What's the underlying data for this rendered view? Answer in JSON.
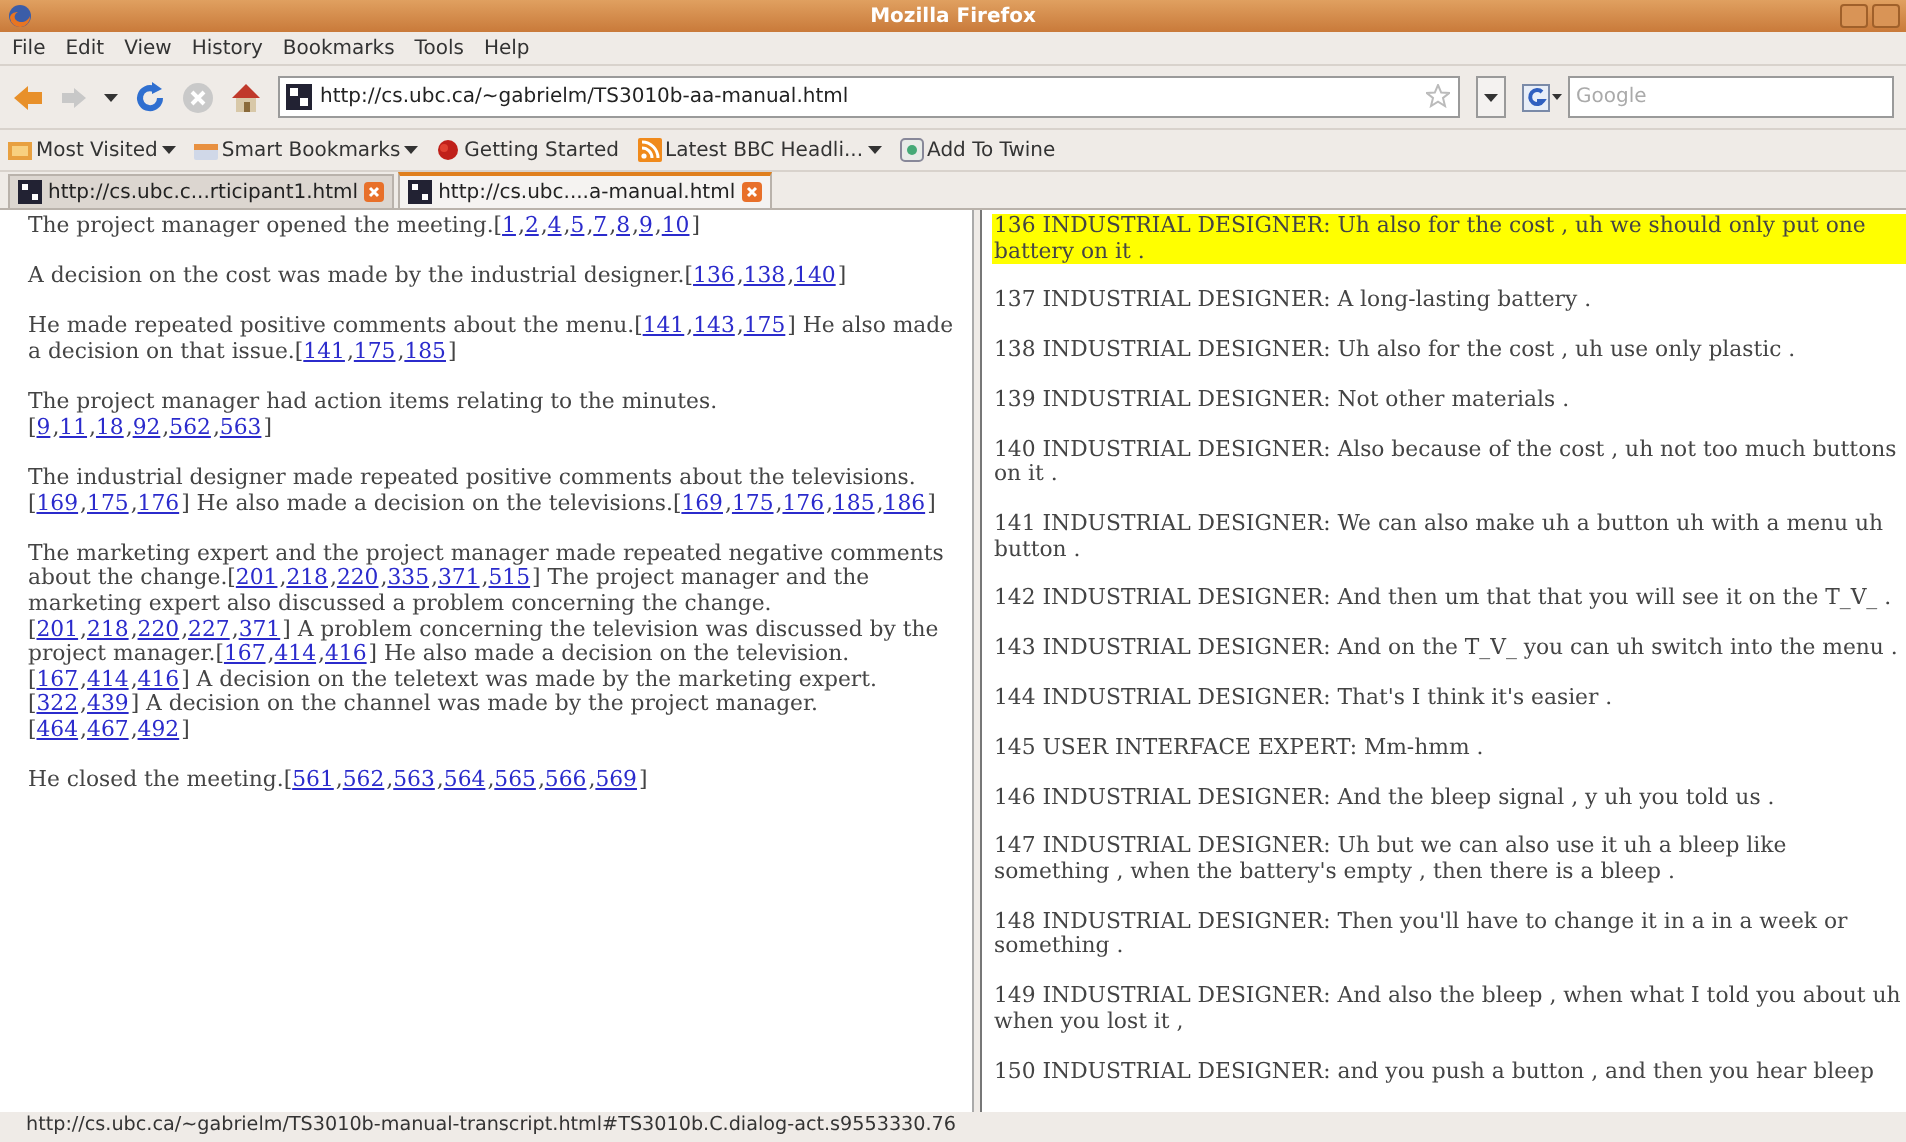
{
  "window": {
    "title": "Mozilla Firefox"
  },
  "menu": [
    "File",
    "Edit",
    "View",
    "History",
    "Bookmarks",
    "Tools",
    "Help"
  ],
  "address_bar": {
    "value": "http://cs.ubc.ca/~gabrielm/TS3010b-aa-manual.html"
  },
  "search": {
    "placeholder": "Google"
  },
  "bookmarks": [
    {
      "label": "Most Visited",
      "dropdown": true
    },
    {
      "label": "Smart Bookmarks",
      "dropdown": true
    },
    {
      "label": "Getting Started",
      "dropdown": false
    },
    {
      "label": "Latest BBC Headli...",
      "dropdown": true
    },
    {
      "label": "Add To Twine",
      "dropdown": false
    }
  ],
  "tabs": [
    {
      "label": "http://cs.ubc.c...rticipant1.html",
      "selected": false
    },
    {
      "label": "http://cs.ubc....a-manual.html",
      "selected": true
    }
  ],
  "summary": [
    [
      "The project manager opened the meeting.[",
      {
        "link": "1",
        "sep": ","
      },
      {
        "link": "2",
        "sep": ","
      },
      {
        "link": "4",
        "sep": ","
      },
      {
        "link": "5",
        "sep": ","
      },
      {
        "link": "7",
        "sep": ","
      },
      {
        "link": "8",
        "sep": ","
      },
      {
        "link": "9",
        "sep": ","
      },
      {
        "link": "10"
      },
      "]"
    ],
    [
      "A decision on the cost was made by the industrial designer.[",
      {
        "link": "136",
        "sep": ","
      },
      {
        "link": "138",
        "sep": ","
      },
      {
        "link": "140"
      },
      "]"
    ],
    [
      "He made repeated positive comments about the menu.[",
      {
        "link": "141",
        "sep": ","
      },
      {
        "link": "143",
        "sep": ","
      },
      {
        "link": "175"
      },
      "] He also made a decision on that issue.[",
      {
        "link": "141",
        "sep": ","
      },
      {
        "link": "175",
        "sep": ","
      },
      {
        "link": "185"
      },
      "]"
    ],
    [
      "The project manager had action items relating to the minutes.[",
      {
        "link": "9",
        "sep": ","
      },
      {
        "link": "11",
        "sep": ","
      },
      {
        "link": "18",
        "sep": ","
      },
      {
        "link": "92",
        "sep": ","
      },
      {
        "link": "562",
        "sep": ","
      },
      {
        "link": "563"
      },
      "]"
    ],
    [
      "The industrial designer made repeated positive comments about the televisions. [",
      {
        "link": "169",
        "sep": ","
      },
      {
        "link": "175",
        "sep": ","
      },
      {
        "link": "176"
      },
      "] He also made a decision on the televisions.[",
      {
        "link": "169",
        "sep": ","
      },
      {
        "link": "175",
        "sep": ","
      },
      {
        "link": "176",
        "sep": ","
      },
      {
        "link": "185",
        "sep": ","
      },
      {
        "link": "186"
      },
      "]"
    ],
    [
      "The marketing expert and the project manager made repeated negative comments about the change.[",
      {
        "link": "201",
        "sep": ","
      },
      {
        "link": "218",
        "sep": ","
      },
      {
        "link": "220",
        "sep": ","
      },
      {
        "link": "335",
        "sep": ","
      },
      {
        "link": "371",
        "sep": ","
      },
      {
        "link": "515"
      },
      "] The project manager and the marketing expert also discussed a problem concerning the change. [",
      {
        "link": "201",
        "sep": ","
      },
      {
        "link": "218",
        "sep": ","
      },
      {
        "link": "220",
        "sep": ","
      },
      {
        "link": "227",
        "sep": ","
      },
      {
        "link": "371"
      },
      "] A problem concerning the television was discussed by the project manager.[",
      {
        "link": "167",
        "sep": ","
      },
      {
        "link": "414",
        "sep": ","
      },
      {
        "link": "416"
      },
      "] He also made a decision on the television. [",
      {
        "link": "167",
        "sep": ","
      },
      {
        "link": "414",
        "sep": ","
      },
      {
        "link": "416"
      },
      "] A decision on the teletext was made by the marketing expert. [",
      {
        "link": "322",
        "sep": ","
      },
      {
        "link": "439"
      },
      "] A decision on the channel was made by the project manager. [",
      {
        "link": "464",
        "sep": ","
      },
      {
        "link": "467",
        "sep": ","
      },
      {
        "link": "492"
      },
      "]"
    ],
    [
      "He closed the meeting.[",
      {
        "link": "561",
        "sep": ","
      },
      {
        "link": "562",
        "sep": ","
      },
      {
        "link": "563",
        "sep": ","
      },
      {
        "link": "564",
        "sep": ","
      },
      {
        "link": "565",
        "sep": ","
      },
      {
        "link": "566",
        "sep": ","
      },
      {
        "link": "569"
      },
      "]"
    ]
  ],
  "transcript": [
    {
      "text": "136 INDUSTRIAL DESIGNER: Uh also for the cost , uh we should only put one battery on it .",
      "highlighted": true
    },
    {
      "text": "137 INDUSTRIAL DESIGNER: A long-lasting battery .",
      "highlighted": false
    },
    {
      "text": "138 INDUSTRIAL DESIGNER: Uh also for the cost , uh use only plastic .",
      "highlighted": false
    },
    {
      "text": "139 INDUSTRIAL DESIGNER: Not other materials .",
      "highlighted": false
    },
    {
      "text": "140 INDUSTRIAL DESIGNER: Also because of the cost , uh not too much buttons on it .",
      "highlighted": false
    },
    {
      "text": "141 INDUSTRIAL DESIGNER: We can also make uh a button uh with a menu uh button .",
      "highlighted": false
    },
    {
      "text": "142 INDUSTRIAL DESIGNER: And then um that that you will see it on the T_V_ .",
      "highlighted": false
    },
    {
      "text": "143 INDUSTRIAL DESIGNER: And on the T_V_ you can uh switch into the menu .",
      "highlighted": false
    },
    {
      "text": "144 INDUSTRIAL DESIGNER: That's I think it's easier .",
      "highlighted": false
    },
    {
      "text": "145 USER INTERFACE EXPERT: Mm-hmm .",
      "highlighted": false
    },
    {
      "text": "146 INDUSTRIAL DESIGNER: And the bleep signal , y uh you told us .",
      "highlighted": false
    },
    {
      "text": "147 INDUSTRIAL DESIGNER: Uh but we can also use it uh a bleep like something , when the battery's empty , then there is a bleep .",
      "highlighted": false
    },
    {
      "text": "148 INDUSTRIAL DESIGNER: Then you'll have to change it in a in a week or something .",
      "highlighted": false
    },
    {
      "text": "149 INDUSTRIAL DESIGNER: And also the bleep , when what I told you about uh when you lost it ,",
      "highlighted": false
    },
    {
      "text": "150 INDUSTRIAL DESIGNER: and you push a button , and then you hear bleep",
      "highlighted": false
    }
  ],
  "status_bar": {
    "text": "http://cs.ubc.ca/~gabrielm/TS3010b-manual-transcript.html#TS3010b.C.dialog-act.s9553330.76"
  }
}
